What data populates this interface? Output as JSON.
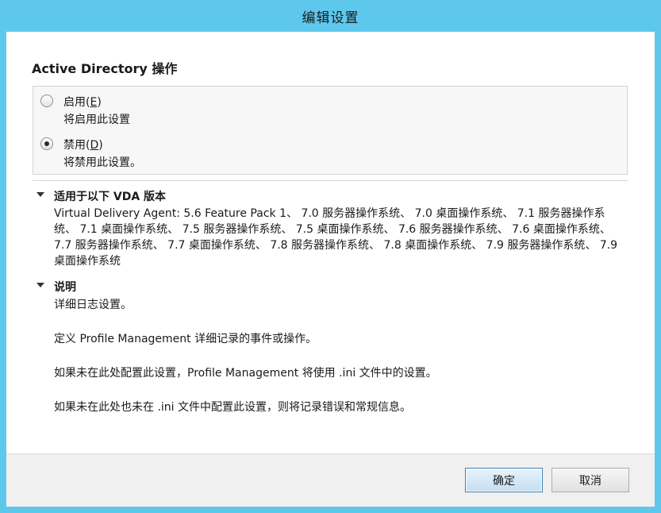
{
  "window": {
    "title": "编辑设置"
  },
  "setting": {
    "heading": "Active Directory 操作",
    "options": [
      {
        "label_text": "启用(",
        "accelerator": "E",
        "label_close": ")",
        "description": "将启用此设置",
        "selected": false
      },
      {
        "label_text": "禁用(",
        "accelerator": "D",
        "label_close": ")",
        "description": "将禁用此设置。",
        "selected": true
      }
    ]
  },
  "applies_to": {
    "title": "适用于以下 VDA 版本",
    "versions": "Virtual Delivery Agent: 5.6 Feature Pack 1、 7.0 服务器操作系统、 7.0 桌面操作系统、 7.1 服务器操作系统、 7.1 桌面操作系统、 7.5 服务器操作系统、 7.5 桌面操作系统、 7.6 服务器操作系统、 7.6 桌面操作系统、 7.7 服务器操作系统、 7.7 桌面操作系统、 7.8 服务器操作系统、 7.8 桌面操作系统、 7.9 服务器操作系统、 7.9 桌面操作系统"
  },
  "description": {
    "title": "说明",
    "lines": [
      "详细日志设置。",
      "定义 Profile Management 详细记录的事件或操作。",
      "如果未在此处配置此设置，Profile Management 将使用 .ini 文件中的设置。",
      "如果未在此处也未在 .ini 文件中配置此设置，则将记录错误和常规信息。"
    ]
  },
  "buttons": {
    "ok": "确定",
    "cancel": "取消"
  },
  "colors": {
    "titlebar": "#5ec8ec",
    "ok_border": "#3c7fb1"
  }
}
